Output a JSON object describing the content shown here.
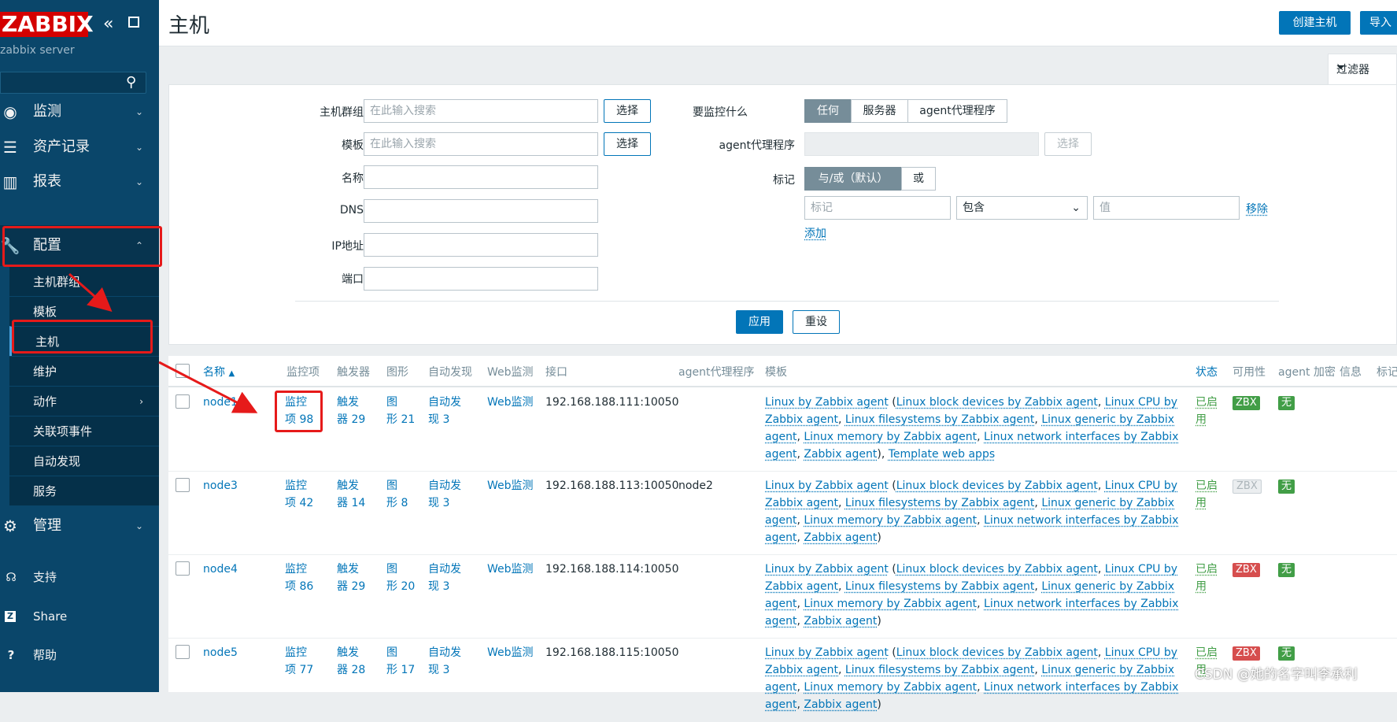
{
  "sidebar": {
    "logo": "ZABBIX",
    "server_name": "zabbix server",
    "menu": {
      "monitoring": "监测",
      "inventory": "资产记录",
      "reports": "报表",
      "configuration": "配置",
      "administration": "管理"
    },
    "submenu": {
      "host_groups": "主机群组",
      "templates": "模板",
      "hosts": "主机",
      "maintenance": "维护",
      "actions": "动作",
      "event_correlation": "关联项事件",
      "discovery": "自动发现",
      "services": "服务"
    },
    "footer": {
      "support": "支持",
      "share": "Share",
      "help": "帮助"
    }
  },
  "header": {
    "title": "主机",
    "create_host": "创建主机",
    "import": "导入"
  },
  "filter": {
    "tab_label": "过滤器",
    "host_groups_label": "主机群组",
    "templates_label": "模板",
    "name_label": "名称",
    "dns_label": "DNS",
    "ip_label": "IP地址",
    "port_label": "端口",
    "search_placeholder": "在此输入搜索",
    "select_label": "选择",
    "monitored_by_label": "要监控什么",
    "monitored_by_options": [
      "任何",
      "服务器",
      "agent代理程序"
    ],
    "proxy_label": "agent代理程序",
    "tags_label": "标记",
    "tags_mode_options": [
      "与/或（默认）",
      "或"
    ],
    "tag_placeholder": "标记",
    "tag_operator": "包含",
    "value_placeholder": "值",
    "remove_label": "移除",
    "add_label": "添加",
    "apply": "应用",
    "reset": "重设"
  },
  "table": {
    "headers": {
      "name": "名称",
      "sort_icon": "▲",
      "items": "监控项",
      "triggers": "触发器",
      "graphs": "图形",
      "discovery": "自动发现",
      "web": "Web监测",
      "interface": "接口",
      "proxy": "agent代理程序",
      "templates": "模板",
      "status": "状态",
      "availability": "可用性",
      "agent_encryption": "agent 加密",
      "info": "信息",
      "tags": "标记"
    },
    "rows": [
      {
        "name": "node1",
        "items_line1": "监控",
        "items_line2": "项 98",
        "triggers_line1": "触发",
        "triggers_line2": "器 29",
        "graphs_line1": "图",
        "graphs_line2": "形 21",
        "discovery_line1": "自动发",
        "discovery_line2": "现 3",
        "web": "Web监测",
        "interface": "192.168.188.111:10050",
        "proxy": "",
        "tmpl_main": "Linux by Zabbix agent",
        "tmpl_parts": [
          "Linux block devices by Zabbix agent",
          "Linux CPU by Zabbix agent",
          "Linux filesystems by Zabbix agent",
          "Linux generic by Zabbix agent",
          "Linux memory by Zabbix agent",
          "Linux network interfaces by Zabbix agent",
          "Zabbix agent"
        ],
        "tmpl_extra": "Template web apps",
        "status_line1": "已启",
        "status_line2": "用",
        "zbx": "ZBX",
        "zbx_state": "green",
        "encryption": "无"
      },
      {
        "name": "node3",
        "items_line1": "监控",
        "items_line2": "项 42",
        "triggers_line1": "触发",
        "triggers_line2": "器 14",
        "graphs_line1": "图",
        "graphs_line2": "形 8",
        "discovery_line1": "自动发",
        "discovery_line2": "现 3",
        "web": "Web监测",
        "interface": "192.168.188.113:10050",
        "proxy": "node2",
        "tmpl_main": "Linux by Zabbix agent",
        "tmpl_parts": [
          "Linux block devices by Zabbix agent",
          "Linux CPU by Zabbix agent",
          "Linux filesystems by Zabbix agent",
          "Linux generic by Zabbix agent",
          "Linux memory by Zabbix agent",
          "Linux network interfaces by Zabbix agent",
          "Zabbix agent"
        ],
        "tmpl_extra": "",
        "status_line1": "已启",
        "status_line2": "用",
        "zbx": "ZBX",
        "zbx_state": "gray",
        "encryption": "无"
      },
      {
        "name": "node4",
        "items_line1": "监控",
        "items_line2": "项 86",
        "triggers_line1": "触发",
        "triggers_line2": "器 29",
        "graphs_line1": "图",
        "graphs_line2": "形 20",
        "discovery_line1": "自动发",
        "discovery_line2": "现 3",
        "web": "Web监测",
        "interface": "192.168.188.114:10050",
        "proxy": "",
        "tmpl_main": "Linux by Zabbix agent",
        "tmpl_parts": [
          "Linux block devices by Zabbix agent",
          "Linux CPU by Zabbix agent",
          "Linux filesystems by Zabbix agent",
          "Linux generic by Zabbix agent",
          "Linux memory by Zabbix agent",
          "Linux network interfaces by Zabbix agent",
          "Zabbix agent"
        ],
        "tmpl_extra": "",
        "status_line1": "已启",
        "status_line2": "用",
        "zbx": "ZBX",
        "zbx_state": "red",
        "encryption": "无"
      },
      {
        "name": "node5",
        "items_line1": "监控",
        "items_line2": "项 77",
        "triggers_line1": "触发",
        "triggers_line2": "器 28",
        "graphs_line1": "图",
        "graphs_line2": "形 17",
        "discovery_line1": "自动发",
        "discovery_line2": "现 3",
        "web": "Web监测",
        "interface": "192.168.188.115:10050",
        "proxy": "",
        "tmpl_main": "Linux by Zabbix agent",
        "tmpl_parts": [
          "Linux block devices by Zabbix agent",
          "Linux CPU by Zabbix agent",
          "Linux filesystems by Zabbix agent",
          "Linux generic by Zabbix agent",
          "Linux memory by Zabbix agent",
          "Linux network interfaces by Zabbix agent",
          "Zabbix agent"
        ],
        "tmpl_extra": "",
        "status_line1": "已启",
        "status_line2": "用",
        "zbx": "ZBX",
        "zbx_state": "red",
        "encryption": "无"
      }
    ]
  },
  "watermark": "CSDN @她的名字叫李承利",
  "colors": {
    "sidebar_bg": "#0a466a",
    "accent": "#0275b8",
    "logo_red": "#d40000",
    "status_green": "#429e47",
    "status_red": "#d64e4e",
    "annotation_red": "#e61a1a"
  },
  "icons": {
    "collapse": "double-chevron-left-icon",
    "expand": "square-icon",
    "search": "search-icon",
    "monitoring": "eye-icon",
    "inventory": "list-icon",
    "reports": "bar-chart-icon",
    "configuration": "wrench-icon",
    "administration": "gear-icon",
    "support": "headset-icon",
    "share": "share-z-icon",
    "help": "question-icon",
    "filter": "funnel-icon"
  }
}
